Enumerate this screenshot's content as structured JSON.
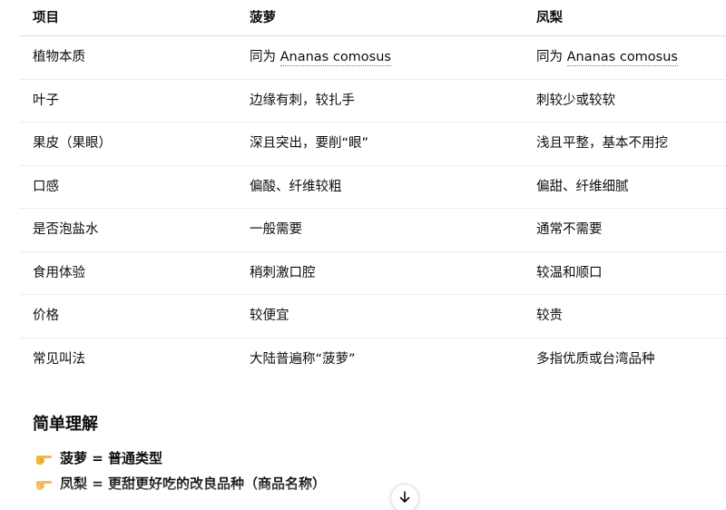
{
  "table": {
    "headers": [
      "项目",
      "菠萝",
      "凤梨"
    ],
    "rows": [
      {
        "item": "植物本质",
        "pineapple_prefix": "同为 ",
        "pineapple_sci": "Ananas comosus",
        "fengli_prefix": "同为 ",
        "fengli_sci": "Ananas comosus"
      },
      {
        "item": "叶子",
        "pineapple": "边缘有刺，较扎手",
        "fengli": "刺较少或较软"
      },
      {
        "item": "果皮（果眼）",
        "pineapple": "深且突出，要削“眼”",
        "fengli": "浅且平整，基本不用挖"
      },
      {
        "item": "口感",
        "pineapple": "偏酸、纤维较粗",
        "fengli": "偏甜、纤维细腻"
      },
      {
        "item": "是否泡盐水",
        "pineapple": "一般需要",
        "fengli": "通常不需要"
      },
      {
        "item": "食用体验",
        "pineapple": "稍刺激口腔",
        "fengli": "较温和顺口"
      },
      {
        "item": "价格",
        "pineapple": "较便宜",
        "fengli": "较贵"
      },
      {
        "item": "常见叫法",
        "pineapple": "大陆普遍称“菠萝”",
        "fengli": "多指优质或台湾品种"
      }
    ]
  },
  "summary": {
    "title": "简单理解",
    "bullets": [
      {
        "icon": "pointing-hand-icon",
        "text": "菠萝 = 普通类型"
      },
      {
        "icon": "pointing-hand-icon",
        "text": "凤梨 = 更甜更好吃的改良品种（商品名称）"
      }
    ]
  },
  "controls": {
    "scroll_down_icon": "arrow-down-icon"
  },
  "colors": {
    "text": "#0d0d0d",
    "divider": "#ececec",
    "hand": "#f4b63f"
  }
}
